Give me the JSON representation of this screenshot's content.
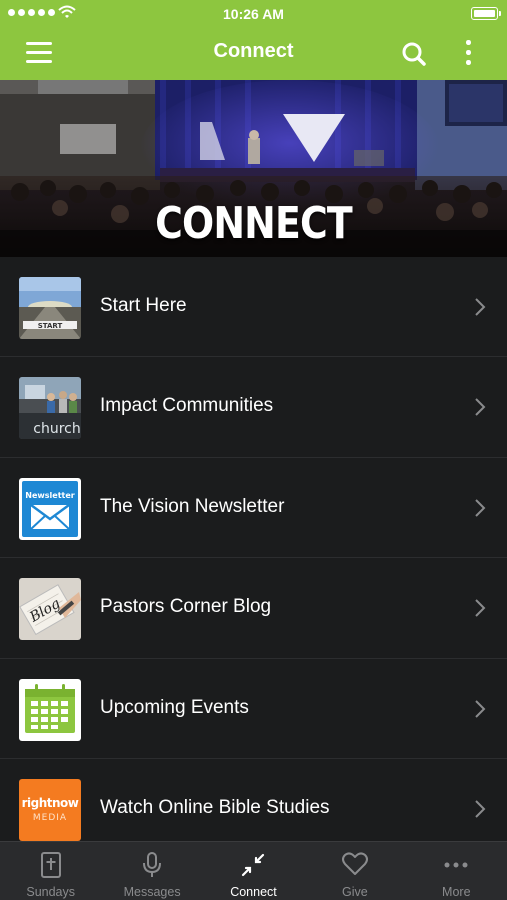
{
  "status_bar": {
    "time": "10:26 AM"
  },
  "nav": {
    "title": "Connect",
    "icons": [
      "hamburger-menu-icon",
      "search-icon",
      "more-vertical-icon"
    ]
  },
  "hero": {
    "title": "CONNECT"
  },
  "list": {
    "items": [
      {
        "label": "Start Here",
        "thumb": "road-start-thumbnail"
      },
      {
        "label": "Impact Communities",
        "thumb": "church-group-thumbnail",
        "thumb_text": "church"
      },
      {
        "label": "The Vision Newsletter",
        "thumb": "newsletter-envelope-thumbnail",
        "thumb_text": "Newsletter"
      },
      {
        "label": "Pastors Corner Blog",
        "thumb": "blog-notepad-thumbnail",
        "thumb_text": "Blog"
      },
      {
        "label": "Upcoming Events",
        "thumb": "calendar-thumbnail"
      },
      {
        "label": "Watch Online Bible Studies",
        "thumb": "rightnow-media-thumbnail",
        "thumb_text_1": "rightnow",
        "thumb_text_2": "MEDIA"
      }
    ]
  },
  "tabs": [
    {
      "label": "Sundays",
      "icon": "bible-icon",
      "active": false
    },
    {
      "label": "Messages",
      "icon": "microphone-icon",
      "active": false
    },
    {
      "label": "Connect",
      "icon": "connect-arrows-icon",
      "active": true
    },
    {
      "label": "Give",
      "icon": "heart-icon",
      "active": false
    },
    {
      "label": "More",
      "icon": "more-dots-icon",
      "active": false
    }
  ],
  "colors": {
    "accent": "#8dc63f",
    "background": "#1b1c1d",
    "tabbar": "#2a2b2d",
    "inactive_tab": "#8a8b8d"
  }
}
